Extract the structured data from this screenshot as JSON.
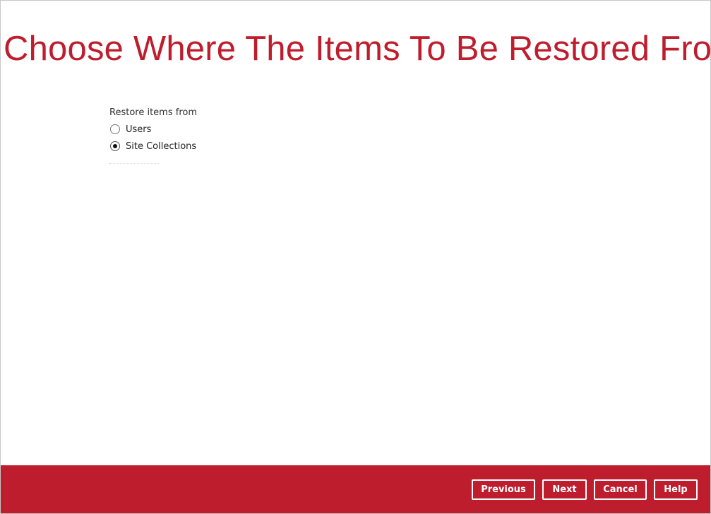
{
  "page": {
    "title": "Choose Where The Items To Be Restored From"
  },
  "restore_source": {
    "label": "Restore items from",
    "options": [
      {
        "label": "Users",
        "selected": false
      },
      {
        "label": "Site Collections",
        "selected": true
      }
    ]
  },
  "footer": {
    "buttons": {
      "previous": "Previous",
      "next": "Next",
      "cancel": "Cancel",
      "help": "Help"
    }
  },
  "colors": {
    "brand": "#be1d2d",
    "footer_background": "#be1d2d",
    "button_text": "#ffffff"
  }
}
